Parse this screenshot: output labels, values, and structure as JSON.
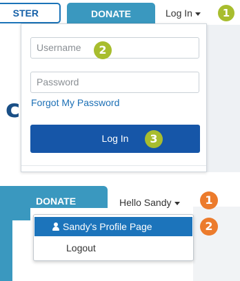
{
  "top": {
    "register_label": "STER",
    "donate_label": "DONATE",
    "login_toggle_label": "Log In",
    "badge_1": "1"
  },
  "login_form": {
    "username_placeholder": "Username",
    "password_placeholder": "Password",
    "forgot_label": "Forgot My Password",
    "submit_label": "Log In",
    "badge_2": "2",
    "badge_3": "3"
  },
  "logged_in": {
    "donate_label": "DONATE",
    "greeting": "Hello Sandy",
    "badge_1": "1",
    "badge_2": "2",
    "menu": {
      "profile_label": "Sandy's Profile Page",
      "logout_label": "Logout"
    }
  },
  "colors": {
    "donate": "#3a98bf",
    "primary_button": "#1656a8",
    "link": "#1b6fb5",
    "menu_highlight": "#1c74bb",
    "badge_green": "#a8bd2e",
    "badge_orange": "#ec7b2c"
  },
  "icons": {
    "login_caret": "caret-down-icon",
    "profile": "user-icon"
  }
}
